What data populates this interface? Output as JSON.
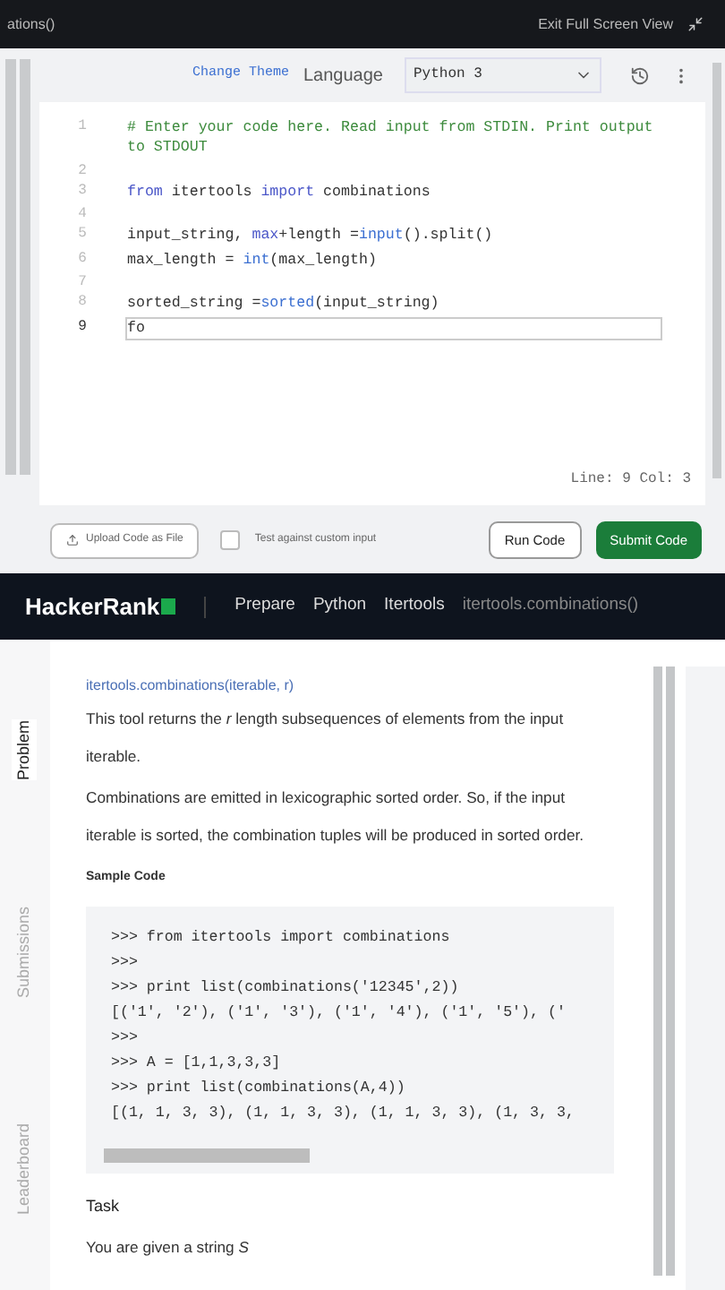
{
  "top_bar": {
    "title": "ations()",
    "exit_label": "Exit Full Screen View"
  },
  "editor": {
    "change_theme": "Change Theme",
    "language_label": "Language",
    "language": "Python 3",
    "lines": [
      {
        "number": "1",
        "active": false,
        "tokens": [
          {
            "kind": "comment",
            "text": "# Enter your code here. Read input from STDIN. Print output to STDOUT"
          }
        ]
      },
      {
        "number": "2",
        "active": false
      },
      {
        "number": "3",
        "active": false,
        "tokens": [
          {
            "kind": "keyword",
            "text": "from"
          },
          {
            "kind": "plain",
            "text": " itertools "
          },
          {
            "kind": "keyword",
            "text": "import"
          },
          {
            "kind": "plain",
            "text": " combinations"
          }
        ]
      },
      {
        "number": "4",
        "active": false
      },
      {
        "number": "5",
        "active": false,
        "tokens": [
          {
            "kind": "plain",
            "text": "input_string, "
          },
          {
            "kind": "keyword",
            "text": "max"
          },
          {
            "kind": "plain",
            "text": "+length ="
          },
          {
            "kind": "builtin",
            "text": "input"
          },
          {
            "kind": "plain",
            "text": "().split()"
          }
        ]
      },
      {
        "number": "6",
        "active": false,
        "tokens": [
          {
            "kind": "plain",
            "text": "max_length = "
          },
          {
            "kind": "builtin",
            "text": "int"
          },
          {
            "kind": "plain",
            "text": "(max_length)"
          }
        ]
      },
      {
        "number": "7",
        "active": false
      },
      {
        "number": "8",
        "active": false,
        "tokens": [
          {
            "kind": "plain",
            "text": "sorted_string ="
          },
          {
            "kind": "builtin",
            "text": "sorted"
          },
          {
            "kind": "plain",
            "text": "(input_string)"
          }
        ]
      },
      {
        "number": "9",
        "active": true,
        "tokens": [
          {
            "kind": "plain",
            "text": "fo"
          }
        ]
      }
    ],
    "status": "Line: 9 Col: 3",
    "upload_label": "Upload Code as File",
    "custom_input": {
      "label": "Test against custom input",
      "checked": false
    },
    "run_label": "Run Code",
    "submit_label": "Submit Code"
  },
  "nav": {
    "logo": "HackerRank",
    "breadcrumbs": [
      {
        "label": "Prepare",
        "current": false
      },
      {
        "label": "Python",
        "current": false
      },
      {
        "label": "Itertools",
        "current": false
      },
      {
        "label": "itertools.combinations()",
        "current": true
      }
    ]
  },
  "side_tabs": [
    {
      "label": "Problem",
      "selected": true
    },
    {
      "label": "Submissions",
      "selected": false
    },
    {
      "label": "Leaderboard",
      "selected": false
    }
  ],
  "problem": {
    "signature": "itertools.combinations(iterable, r)",
    "paragraphs": [
      "This tool returns the *r* length subsequences of elements from the input iterable.",
      "Combinations are emitted in lexicographic sorted order. So, if the input iterable is sorted, the combination tuples will be produced in sorted order."
    ],
    "sample_heading": "Sample Code",
    "sample_lines": [
      ">>> from itertools import combinations",
      ">>>",
      ">>> print list(combinations('12345',2))",
      "[('1', '2'), ('1', '3'), ('1', '4'), ('1', '5'), ('",
      ">>>",
      ">>> A = [1,1,3,3,3]",
      ">>> print list(combinations(A,4))",
      "[(1, 1, 3, 3), (1, 1, 3, 3), (1, 1, 3, 3), (1, 3, 3,"
    ],
    "task_heading": "Task",
    "task_text": "You are given a string *S*"
  }
}
